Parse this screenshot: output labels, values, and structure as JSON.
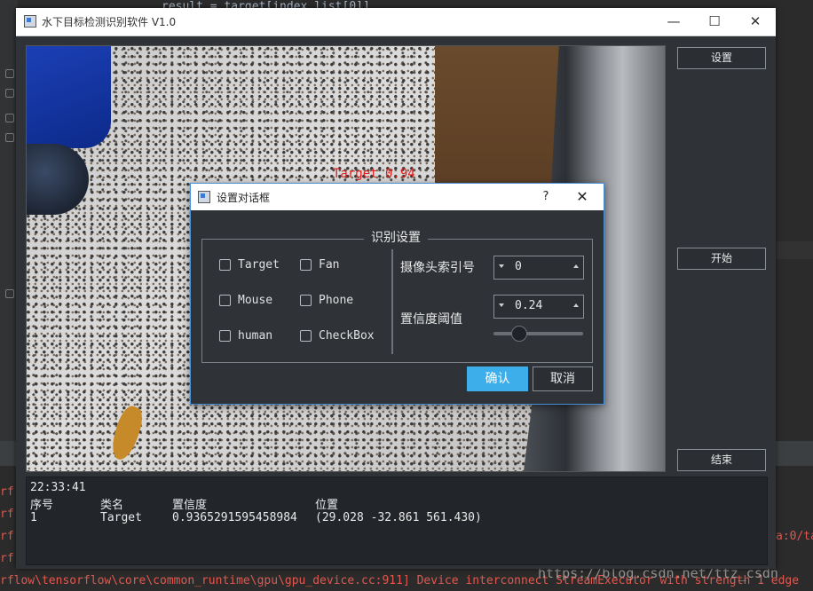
{
  "ide": {
    "code_fragment": "result = target[index_list[0]]",
    "console_left_fragment": "rf",
    "console_right_fragment": "a:0/ta",
    "console_line": "rflow\\tensorflow\\core\\common_runtime\\gpu\\gpu_device.cc:911] Device interconnect StreamExecutor with strength 1 edge",
    "watermark": "https://blog.csdn.net/ttz_csdn"
  },
  "window": {
    "title": "水下目标检测识别软件 V1.0",
    "minimize": "—",
    "maximize": "☐",
    "close": "✕"
  },
  "video": {
    "detection_label": "Target 0.94"
  },
  "side_buttons": {
    "settings": "设置",
    "start": "开始",
    "stop": "结束"
  },
  "results": {
    "time": "22:33:41",
    "headers": [
      "序号",
      "类名",
      "置信度",
      "位置"
    ],
    "rows": [
      [
        "1",
        "Target",
        "0.9365291595458984",
        "(29.028  -32.861  561.430)"
      ]
    ]
  },
  "dialog": {
    "title": "设置对话框",
    "help": "?",
    "close": "✕",
    "group_title": "识别设置",
    "checkboxes": [
      {
        "label": "Target",
        "checked": false
      },
      {
        "label": "Fan",
        "checked": false
      },
      {
        "label": "Mouse",
        "checked": false
      },
      {
        "label": "Phone",
        "checked": false
      },
      {
        "label": "human",
        "checked": false
      },
      {
        "label": "CheckBox",
        "checked": false
      }
    ],
    "camera_index_label": "摄像头索引号",
    "camera_index_value": "0",
    "confidence_label": "置信度阈值",
    "confidence_value": "0.24",
    "slider_fraction": 0.24,
    "ok": "确认",
    "cancel": "取消"
  },
  "colors": {
    "accent": "#3daee9",
    "detection": "#e02020",
    "console_error": "#e0584f"
  }
}
